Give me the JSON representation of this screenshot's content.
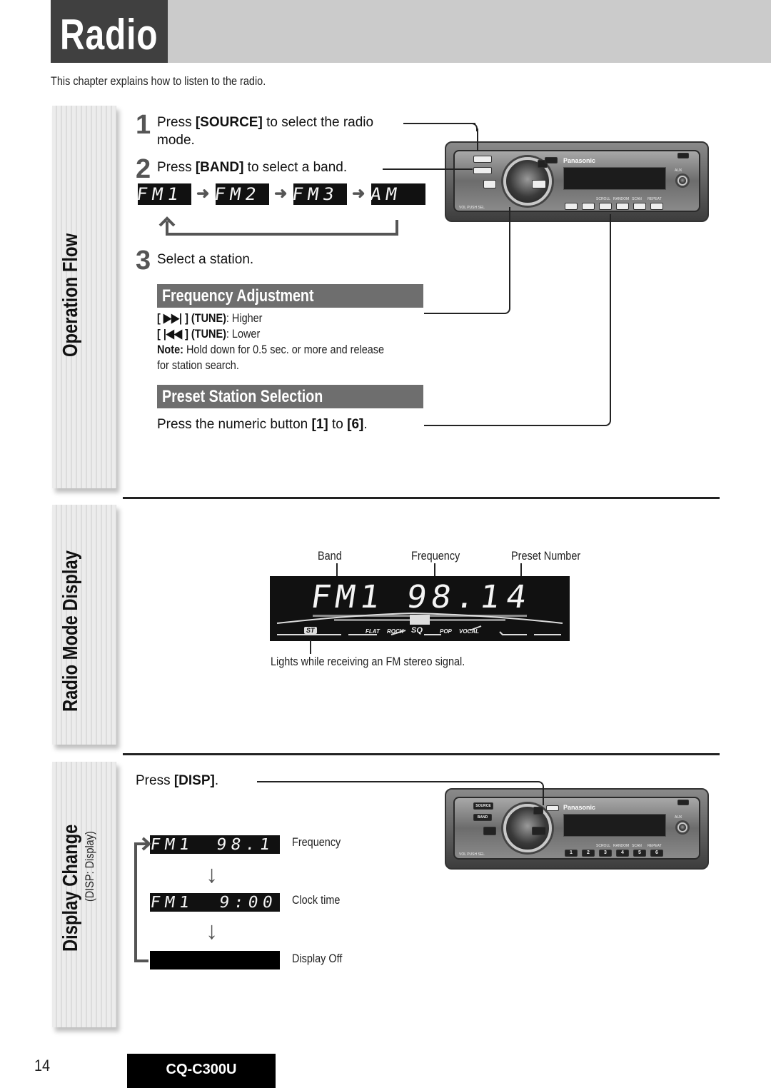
{
  "header": {
    "title": "Radio",
    "intro": "This chapter explains how to listen to the radio."
  },
  "sections": {
    "operation_flow": "Operation Flow",
    "radio_mode_display": "Radio Mode Display",
    "display_change": "Display Change",
    "display_change_sub": "(DISP: Display)"
  },
  "steps": [
    {
      "num": "1",
      "pre": "Press ",
      "key": "[SOURCE]",
      "post": " to select the radio",
      "cont": "mode."
    },
    {
      "num": "2",
      "pre": "Press ",
      "key": "[BAND]",
      "post": " to select a band."
    },
    {
      "num": "3",
      "text": "Select a station."
    }
  ],
  "bands": [
    "FM1",
    "FM2",
    "FM3",
    "AM"
  ],
  "frequency_adjustment": {
    "title": "Frequency Adjustment",
    "higher_key": "[ ▶▶| ] (TUNE)",
    "higher_text": ": Higher",
    "lower_key": "[ |◀◀ ] (TUNE)",
    "lower_text": ": Lower",
    "note_label": "Note:",
    "note_text": " Hold down for 0.5 sec. or more and release",
    "note_cont": "for station search."
  },
  "preset_selection": {
    "title": "Preset Station Selection",
    "pre": "Press the numeric button ",
    "k1": "[1]",
    "mid": " to ",
    "k2": "[6]",
    "post": "."
  },
  "radio_display": {
    "label_band": "Band",
    "label_frequency": "Frequency",
    "label_preset": "Preset Number",
    "band": "FM1",
    "frequency": "98.1",
    "preset": "4",
    "eq_labels": [
      "ST",
      "FLAT",
      "ROCK",
      "SQ",
      "POP",
      "VOCAL"
    ],
    "stereo_note": "Lights while receiving an FM stereo signal."
  },
  "display_change": {
    "instruction_pre": "Press ",
    "instruction_key": "[DISP]",
    "instruction_post": ".",
    "modes": [
      {
        "lcd_band": "FM1",
        "lcd_value": "98.1",
        "label": "Frequency"
      },
      {
        "lcd_band": "FM1",
        "lcd_value": "9:00",
        "label": "Clock time"
      },
      {
        "lcd_band": "",
        "lcd_value": "",
        "label": "Display Off"
      }
    ]
  },
  "radio_unit": {
    "brand": "Panasonic",
    "buttons": {
      "source": "SOURCE",
      "band": "BAND",
      "disp": "DISP",
      "prev": "⏮",
      "next": "⏭",
      "aux": "AUX"
    },
    "labels": [
      "SCROLL",
      "RANDOM",
      "SCAN",
      "REPEAT"
    ],
    "presets": [
      "1",
      "2",
      "3",
      "4",
      "5",
      "6"
    ],
    "vol_label": "VOL PUSH SEL"
  },
  "footer": {
    "page_number": "14",
    "model": "CQ-C300U"
  }
}
